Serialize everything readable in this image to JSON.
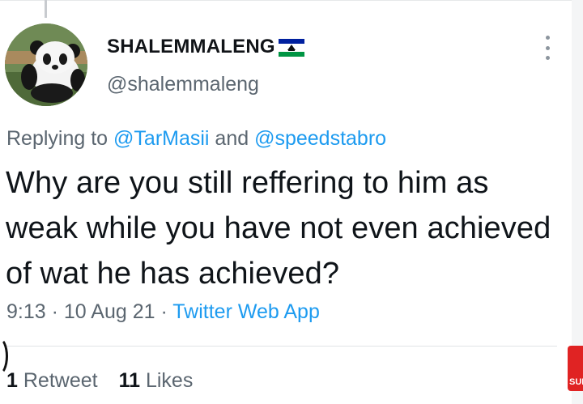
{
  "tweet": {
    "display_name": "SHALEMMALENG",
    "flag_icon": "lesotho-flag-icon",
    "handle": "@shalemmaleng",
    "replying_prefix": "Replying to ",
    "mentions": [
      "@TarMasii",
      "@speedstabro"
    ],
    "replying_joiner": " and ",
    "text": "Why are you still reffering to him as weak while you have not even achieved of wat he has achieved?",
    "time": "9:13",
    "separator": " · ",
    "date": "10 Aug 21",
    "app": "Twitter Web App",
    "retweets_count": "1",
    "retweets_label": "Retweet",
    "likes_count": "11",
    "likes_label": "Likes"
  },
  "overlay": {
    "subscribe_label": "SUB"
  },
  "colors": {
    "link_blue": "#1d9bf0",
    "secondary_text": "#5b6670",
    "subscribe_red": "#e02323"
  }
}
